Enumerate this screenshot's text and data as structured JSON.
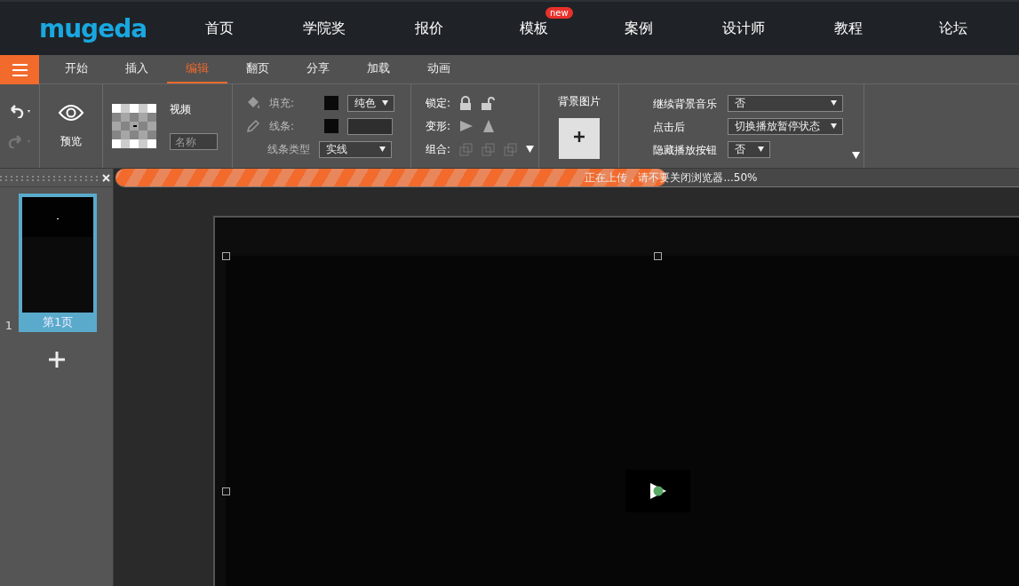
{
  "brand": "mugeda",
  "nav": [
    {
      "label": "首页"
    },
    {
      "label": "学院奖"
    },
    {
      "label": "报价"
    },
    {
      "label": "模板",
      "badge": "new"
    },
    {
      "label": "案例"
    },
    {
      "label": "设计师"
    },
    {
      "label": "教程"
    },
    {
      "label": "论坛"
    }
  ],
  "menu_tabs": [
    {
      "label": "开始",
      "selected": false
    },
    {
      "label": "插入",
      "selected": false
    },
    {
      "label": "编辑",
      "selected": true
    },
    {
      "label": "翻页",
      "selected": false
    },
    {
      "label": "分享",
      "selected": false
    },
    {
      "label": "加载",
      "selected": false
    },
    {
      "label": "动画",
      "selected": false
    }
  ],
  "toolbar": {
    "preview": "预览",
    "video": {
      "label": "视频",
      "name_placeholder": "名称"
    },
    "fill": {
      "label": "填充:",
      "value": "纯色"
    },
    "stroke": {
      "label": "线条:"
    },
    "line_type": {
      "label": "线条类型",
      "value": "实线"
    },
    "lock": "锁定:",
    "transform": "变形:",
    "group": "组合:",
    "bg_image": "背景图片",
    "settings": [
      {
        "label": "继续背景音乐",
        "value": "否",
        "wide": true
      },
      {
        "label": "点击后",
        "value": "切换播放暂停状态",
        "wide": true
      },
      {
        "label": "隐藏播放按钮",
        "value": "否",
        "wide": false
      }
    ]
  },
  "upload": {
    "text": "正在上传，请不要关闭浏览器...50%",
    "level": 0.61
  },
  "pages": [
    {
      "number": "1",
      "label": "第1页",
      "selected": true
    }
  ]
}
